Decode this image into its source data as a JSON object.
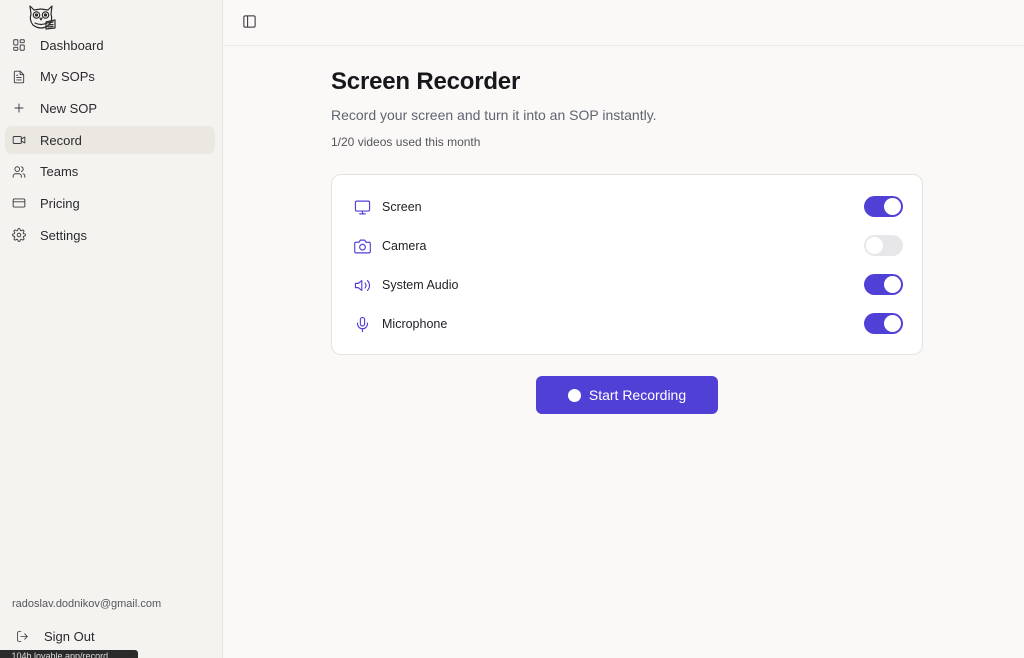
{
  "sidebar": {
    "items": [
      {
        "label": "Dashboard",
        "icon": "dashboard-icon"
      },
      {
        "label": "My SOPs",
        "icon": "document-icon"
      },
      {
        "label": "New SOP",
        "icon": "plus-icon"
      },
      {
        "label": "Record",
        "icon": "video-icon",
        "active": true
      },
      {
        "label": "Teams",
        "icon": "users-icon"
      },
      {
        "label": "Pricing",
        "icon": "credit-card-icon"
      },
      {
        "label": "Settings",
        "icon": "gear-icon"
      }
    ],
    "email": "radoslav.dodnikov@gmail.com",
    "sign_out": "Sign Out",
    "status_url": "...104b.lovable.app/record"
  },
  "main": {
    "title": "Screen Recorder",
    "subtitle": "Record your screen and turn it into an SOP instantly.",
    "usage": "1/20 videos used this month",
    "options": [
      {
        "label": "Screen",
        "icon": "monitor-icon",
        "enabled": true
      },
      {
        "label": "Camera",
        "icon": "camera-icon",
        "enabled": false
      },
      {
        "label": "System Audio",
        "icon": "speaker-icon",
        "enabled": true
      },
      {
        "label": "Microphone",
        "icon": "microphone-icon",
        "enabled": true
      }
    ],
    "record_button": "Start Recording"
  },
  "colors": {
    "accent": "#5140d6",
    "sidebar_bg": "#f5f3f0",
    "active_item_bg": "#ebe7e1",
    "toggle_off": "#e7e6e9"
  }
}
